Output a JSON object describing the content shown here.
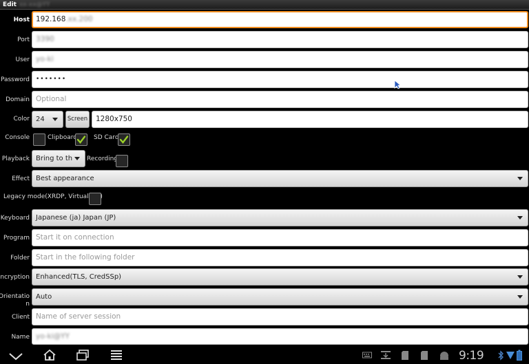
{
  "window": {
    "title": "Edit",
    "title_suffix_blurred": "xx-xx@YY"
  },
  "form": {
    "host": {
      "label": "Host",
      "value": "192.168",
      "value_blurred": ".xx.200"
    },
    "port": {
      "label": "Port",
      "value_blurred": "3390"
    },
    "user": {
      "label": "User",
      "value_blurred": "yo-ki"
    },
    "password": {
      "label": "Password",
      "value": "•••••••"
    },
    "domain": {
      "label": "Domain",
      "placeholder": "Optional"
    },
    "color": {
      "label": "Color",
      "selected": "24",
      "screen_button": "Screen",
      "resolution": "1280x750"
    },
    "console": {
      "label": "Console",
      "checked": false
    },
    "clipboard": {
      "label": "Clipboard",
      "checked": true
    },
    "sdcard": {
      "label": "SD Card",
      "checked": true
    },
    "playback": {
      "label": "Playback",
      "selected": "Bring to th"
    },
    "recording": {
      "label": "Recording",
      "checked": false
    },
    "effect": {
      "label": "Effect",
      "selected": "Best appearance"
    },
    "legacy": {
      "label": "Legacy mode(XRDP, VirtualBox)",
      "checked": false
    },
    "keyboard": {
      "label": "Keyboard",
      "selected": "Japanese (ja) Japan (JP)"
    },
    "program": {
      "label": "Program",
      "placeholder": "Start it on connection"
    },
    "folder": {
      "label": "Folder",
      "placeholder": "Start in the following folder"
    },
    "encryption": {
      "label": "Encryption",
      "selected": "Enhanced(TLS, CredSSp)"
    },
    "orientation": {
      "label_line1": "Orientatio",
      "label_line2": "n",
      "selected": "Auto"
    },
    "client": {
      "label": "Client",
      "placeholder": "Name of server session"
    },
    "name": {
      "label": "Name",
      "value_blurred": "yo-ki@YY"
    }
  },
  "statusbar": {
    "time": "9:19"
  },
  "colors": {
    "focus_border": "#f08c1e",
    "check": "#9bd12a"
  }
}
